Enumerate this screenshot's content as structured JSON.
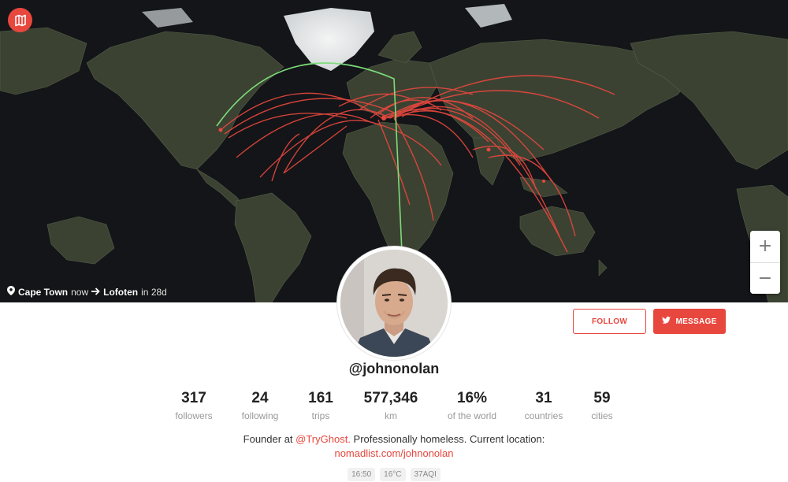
{
  "app": {
    "logo_icon": "map-logo-icon",
    "accent_color": "#e8473e"
  },
  "map": {
    "route_colors": {
      "past_trips": "#e8473e",
      "next_trip": "#7ddc7a"
    },
    "location": {
      "current_city": "Cape Town",
      "current_suffix": "now",
      "next_city": "Lofoten",
      "next_suffix": "in 28d"
    },
    "zoom": {
      "in_label": "+",
      "out_label": "−"
    }
  },
  "profile": {
    "username": "@johnonolan",
    "follow_label": "FOLLOW",
    "message_label": "MESSAGE",
    "stats": [
      {
        "value": "317",
        "label": "followers"
      },
      {
        "value": "24",
        "label": "following"
      },
      {
        "value": "161",
        "label": "trips"
      },
      {
        "value": "577,346",
        "label": "km"
      },
      {
        "value": "16%",
        "label": "of the world"
      },
      {
        "value": "31",
        "label": "countries"
      },
      {
        "value": "59",
        "label": "cities"
      }
    ],
    "bio": {
      "prefix": "Founder at ",
      "mention": "@TryGhost.",
      "suffix": " Professionally homeless. Current location:",
      "link": "nomadlist.com/johnonolan"
    },
    "chips": [
      "16:50",
      "16°C",
      "37AQI"
    ]
  }
}
